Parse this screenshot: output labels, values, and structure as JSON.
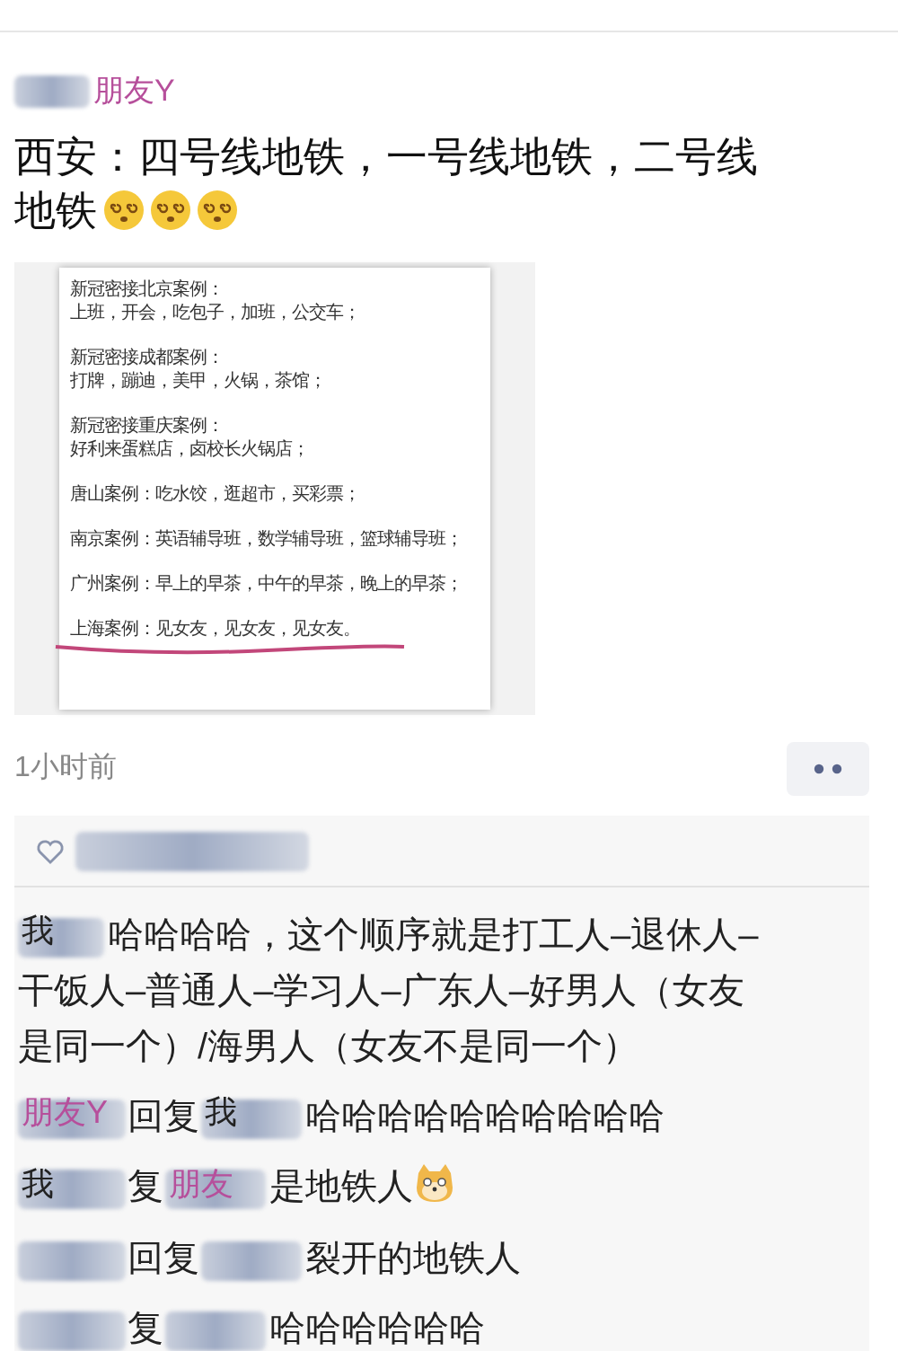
{
  "post": {
    "author": {
      "label": "朋友Y",
      "color": "#b64f9b"
    },
    "text_lines": [
      "西安：四号线地铁，一号线地铁，二号线",
      "地铁"
    ],
    "document": {
      "blocks": [
        {
          "lines": [
            "新冠密接北京案例：",
            "上班，开会，吃包子，加班，公交车；"
          ],
          "underlined": false
        },
        {
          "lines": [
            "新冠密接成都案例：",
            "打牌，蹦迪，美甲，火锅，茶馆；"
          ],
          "underlined": false
        },
        {
          "lines": [
            "新冠密接重庆案例：",
            "好利来蛋糕店，卤校长火锅店；"
          ],
          "underlined": false
        },
        {
          "lines": [
            "唐山案例：吃水饺，逛超市，买彩票；"
          ],
          "underlined": false
        },
        {
          "lines": [
            "南京案例：英语辅导班，数学辅导班，篮球辅导班；"
          ],
          "underlined": false
        },
        {
          "lines": [
            "广州案例：早上的早茶，中午的早茶，晚上的早茶；"
          ],
          "underlined": false
        },
        {
          "lines": [
            "上海案例：见女友，见女友，见女友。"
          ],
          "underlined": true
        }
      ]
    },
    "time": "1小时前"
  },
  "comments": [
    {
      "author": {
        "label": "我",
        "color": "#222222"
      },
      "text_lines": [
        "哈哈哈哈，这个顺序就是打工人–退休人–",
        "干饭人–普通人–学习人–广东人–好男人（女友",
        "是同一个）/海男人（女友不是同一个）"
      ]
    },
    {
      "author": {
        "label": "朋友Y",
        "color": "#b64f9b"
      },
      "reply_word": "回复",
      "target": {
        "label": "我",
        "color": "#222222"
      },
      "text": "哈哈哈哈哈哈哈哈哈哈"
    },
    {
      "author": {
        "label": "我",
        "color": "#222222"
      },
      "reply_word": "复",
      "target": {
        "label": "朋友",
        "color": "#b64f9b"
      },
      "text": "是地铁人",
      "has_emoji": true
    },
    {
      "reply_word": "回复",
      "text": "裂开的地铁人"
    },
    {
      "reply_word": "复",
      "text": "哈哈哈哈哈哈"
    }
  ]
}
